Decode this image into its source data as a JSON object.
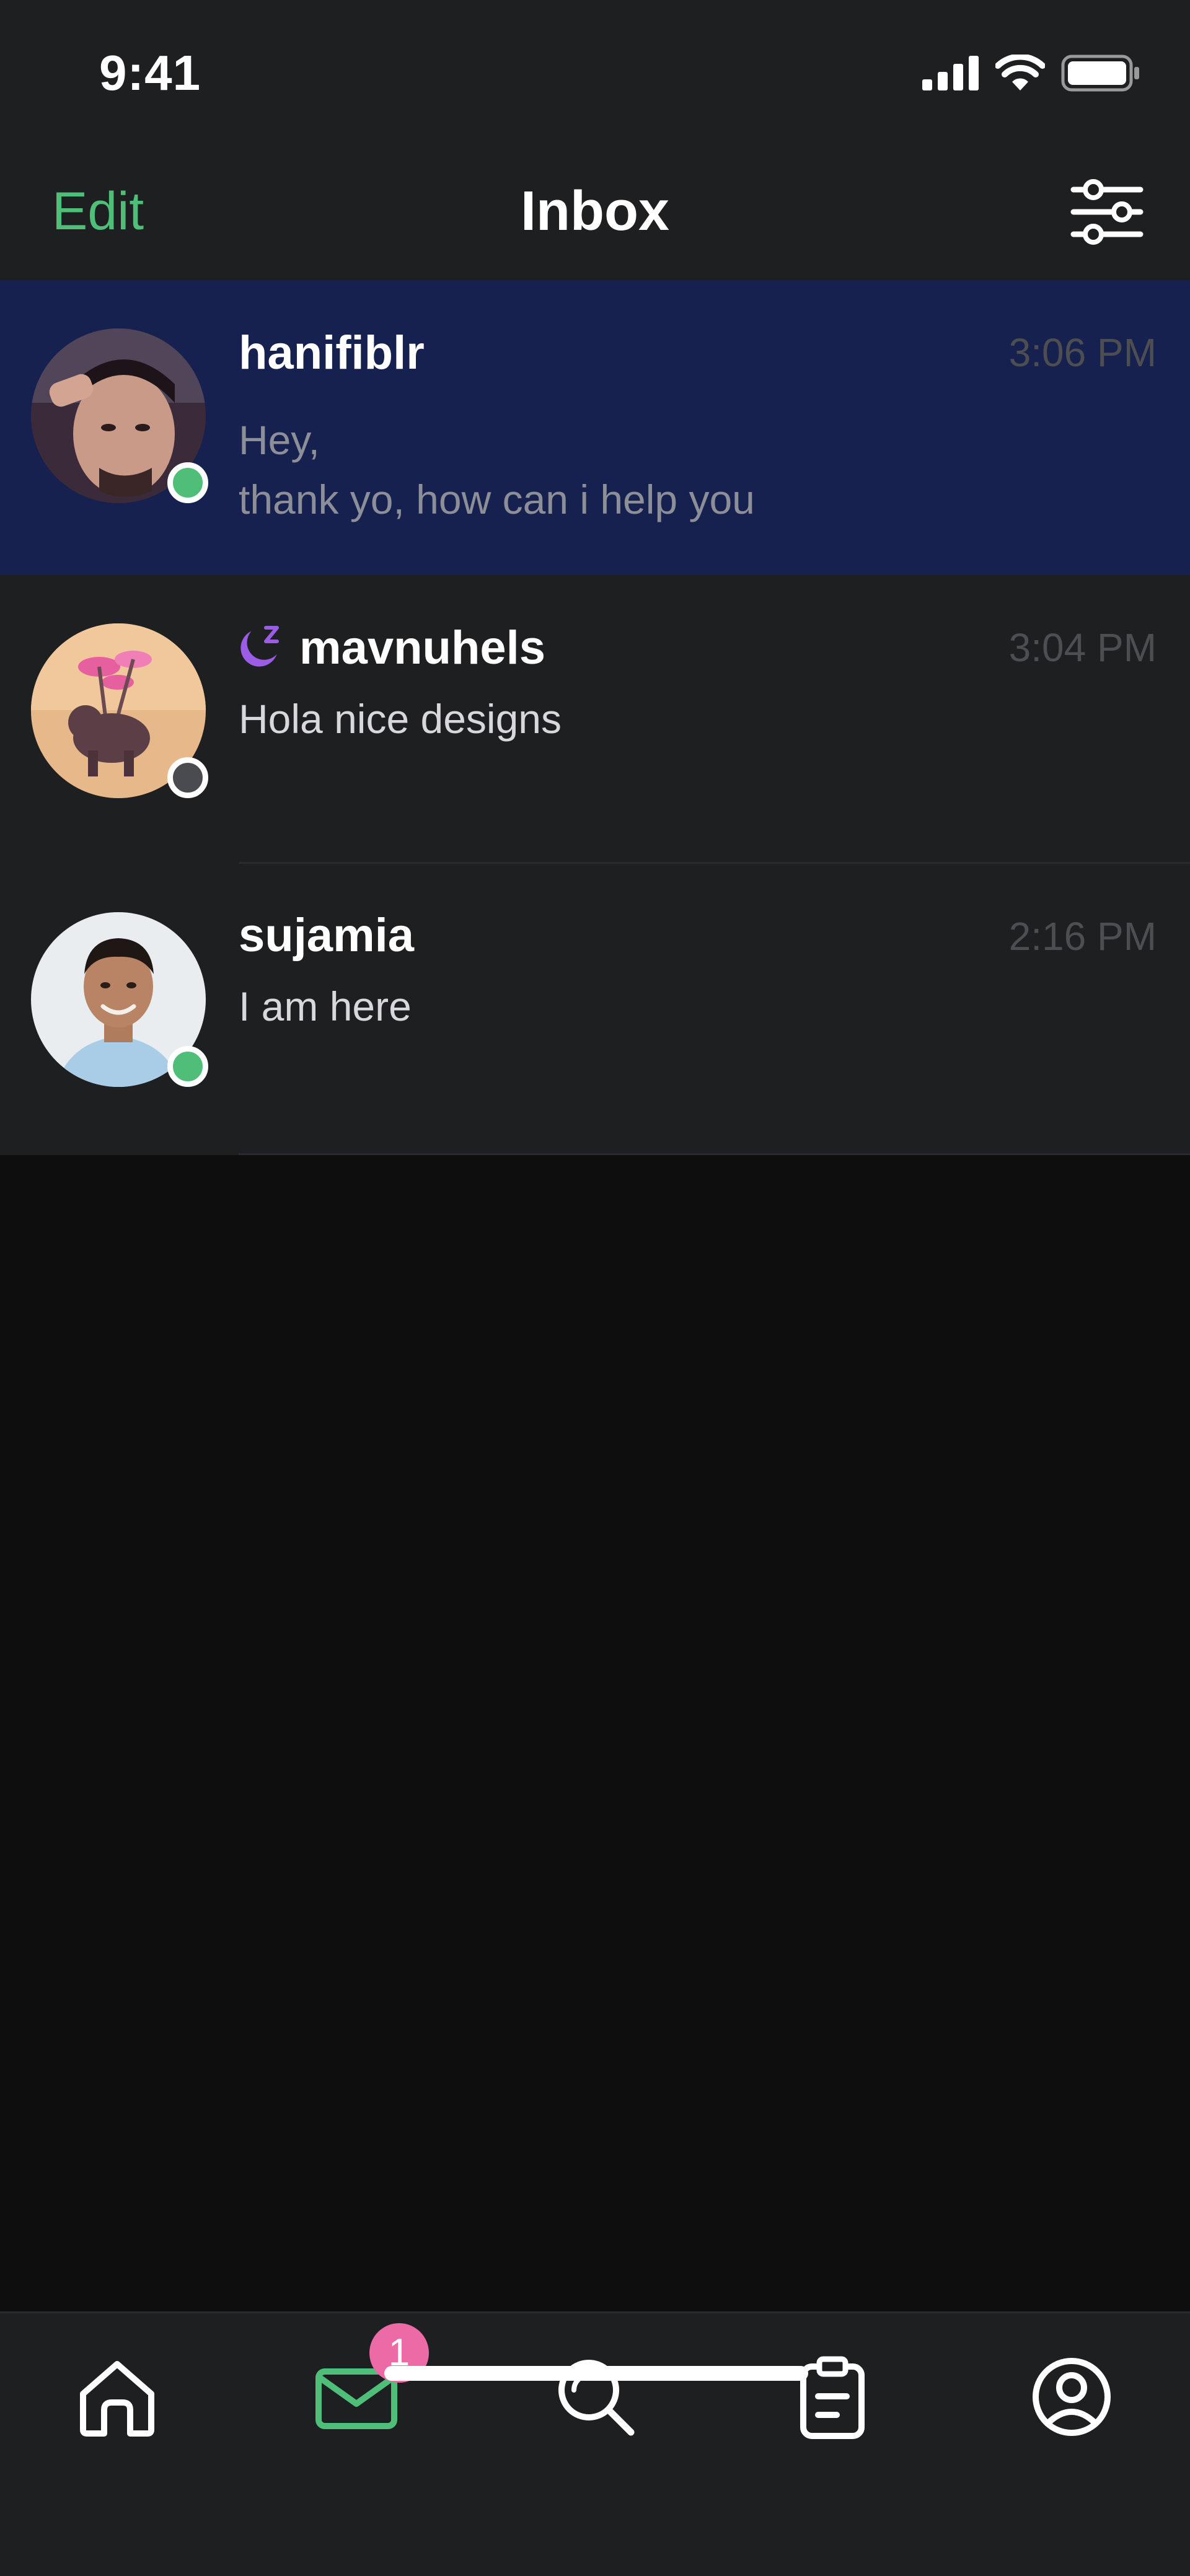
{
  "status_bar": {
    "time": "9:41",
    "icons": [
      "cellular-signal-icon",
      "wifi-icon",
      "battery-icon"
    ]
  },
  "nav": {
    "edit_label": "Edit",
    "title": "Inbox",
    "filter_icon": "sliders-icon"
  },
  "colors": {
    "accent": "#4fbe79",
    "selected_row": "#172150",
    "row_bg": "#1e1f21",
    "badge": "#ec6aa6",
    "dnd_icon": "#9b5de5"
  },
  "conversations": [
    {
      "username": "hanifiblr",
      "time": "3:06 PM",
      "preview_line1": "Hey,",
      "preview_line2": "thank yo, how can i help you",
      "presence": "online",
      "selected": true
    },
    {
      "username": "mavnuhels",
      "time": "3:04 PM",
      "preview_line1": "Hola nice designs",
      "presence": "away",
      "status_icon": "do-not-disturb-moon-icon"
    },
    {
      "username": "sujamia",
      "time": "2:16 PM",
      "preview_line1": "I am here",
      "presence": "online"
    }
  ],
  "tab_bar": {
    "tabs": [
      "home-icon",
      "mail-icon",
      "search-icon",
      "clipboard-icon",
      "profile-icon"
    ],
    "active_tab": "mail-icon",
    "mail_badge": "1"
  }
}
